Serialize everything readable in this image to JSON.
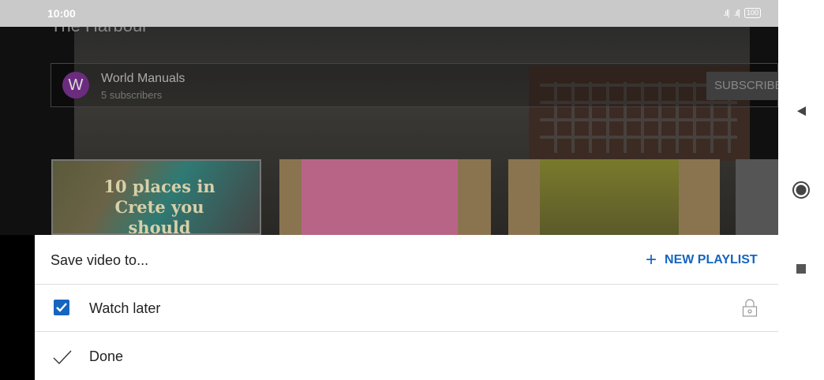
{
  "status_bar": {
    "time": "10:00",
    "signal1": ".ıl|",
    "signal2": ".ıl|",
    "battery": "100"
  },
  "background": {
    "video_title": "The Harbour",
    "channel": {
      "avatar_letter": "W",
      "name": "World Manuals",
      "subscribers": "5 subscribers",
      "subscribe_label": "SUBSCRIBE"
    },
    "thumbnails": [
      {
        "text": "10 places in Crete you should"
      }
    ]
  },
  "sheet": {
    "title": "Save video to...",
    "new_playlist_label": "NEW PLAYLIST",
    "items": [
      {
        "label": "Watch later",
        "checked": true,
        "private": true
      }
    ],
    "done_label": "Done"
  },
  "colors": {
    "accent": "#1565c0",
    "avatar": "#6b2c7f"
  },
  "icons": {
    "nav_back": "back-triangle-icon",
    "nav_home": "home-circle-icon",
    "nav_recent": "recent-square-icon",
    "add": "plus-icon",
    "lock": "lock-icon",
    "done": "checkmark-icon"
  }
}
